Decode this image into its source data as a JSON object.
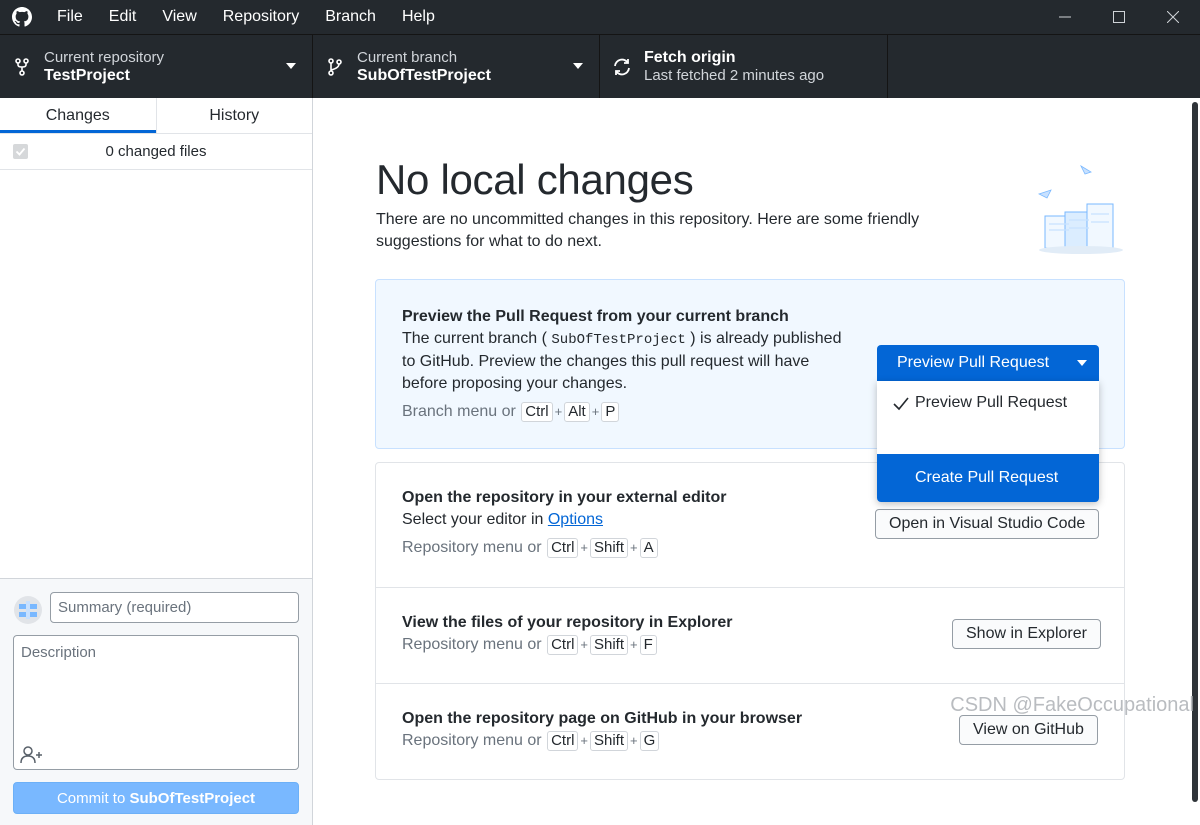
{
  "menu": [
    "File",
    "Edit",
    "View",
    "Repository",
    "Branch",
    "Help"
  ],
  "toolbar": {
    "repo_label": "Current repository",
    "repo_value": "TestProject",
    "branch_label": "Current branch",
    "branch_value": "SubOfTestProject",
    "fetch_title": "Fetch origin",
    "fetch_sub": "Last fetched 2 minutes ago"
  },
  "sidebar": {
    "tabs": [
      "Changes",
      "History"
    ],
    "active_tab": "Changes",
    "changed_files": "0 changed files",
    "summary_placeholder": "Summary (required)",
    "description_placeholder": "Description",
    "commit_prefix": "Commit to",
    "commit_branch": "SubOfTestProject"
  },
  "main": {
    "title": "No local changes",
    "subtitle": "There are no uncommitted changes in this repository. Here are some friendly suggestions for what to do next.",
    "pr_card": {
      "title": "Preview the Pull Request from your current branch",
      "desc_before": "The current branch (",
      "branch_code": "SubOfTestProject",
      "desc_after": ") is already published to GitHub. Preview the changes this pull request will have before proposing your changes.",
      "hint_prefix": "Branch menu or",
      "keys": [
        "Ctrl",
        "Alt",
        "P"
      ],
      "button": "Preview Pull Request",
      "dropdown": [
        "Preview Pull Request",
        "Create Pull Request"
      ]
    },
    "editor": {
      "title": "Open the repository in your external editor",
      "desc_prefix": "Select your editor in",
      "desc_link": "Options",
      "hint_prefix": "Repository menu or",
      "keys": [
        "Ctrl",
        "Shift",
        "A"
      ],
      "button": "Open in Visual Studio Code"
    },
    "explorer": {
      "title": "View the files of your repository in Explorer",
      "hint_prefix": "Repository menu or",
      "keys": [
        "Ctrl",
        "Shift",
        "F"
      ],
      "button": "Show in Explorer"
    },
    "github": {
      "title": "Open the repository page on GitHub in your browser",
      "hint_prefix": "Repository menu or",
      "keys": [
        "Ctrl",
        "Shift",
        "G"
      ],
      "button": "View on GitHub"
    }
  },
  "watermark": "CSDN @FakeOccupational",
  "colors": {
    "accent": "#0366d6",
    "dark": "#24292e",
    "commit_disabled": "#79b8ff"
  }
}
